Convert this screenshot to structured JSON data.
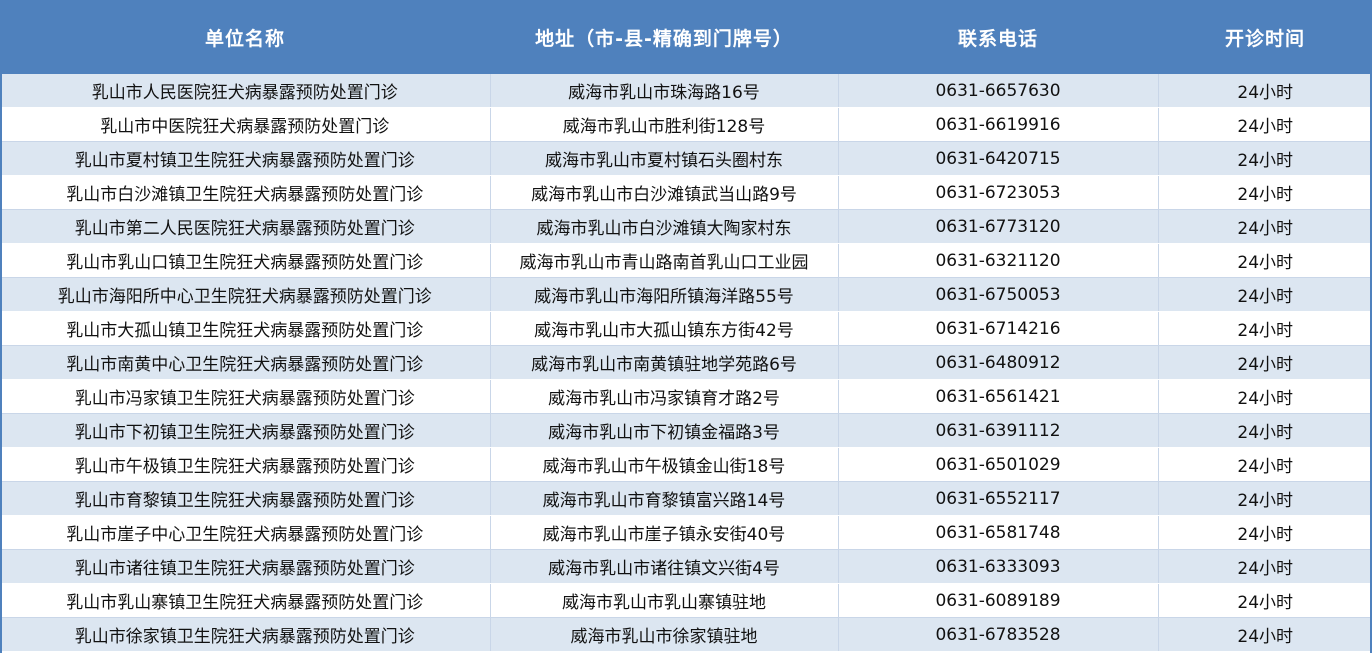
{
  "table": {
    "headers": [
      "单位名称",
      "地址（市-县-精确到门牌号）",
      "联系电话",
      "开诊时间"
    ],
    "rows": [
      [
        "乳山市人民医院狂犬病暴露预防处置门诊",
        "威海市乳山市珠海路16号",
        "0631-6657630",
        "24小时"
      ],
      [
        "乳山市中医院狂犬病暴露预防处置门诊",
        "威海市乳山市胜利街128号",
        "0631-6619916",
        "24小时"
      ],
      [
        "乳山市夏村镇卫生院狂犬病暴露预防处置门诊",
        "威海市乳山市夏村镇石头圈村东",
        "0631-6420715",
        "24小时"
      ],
      [
        "乳山市白沙滩镇卫生院狂犬病暴露预防处置门诊",
        "威海市乳山市白沙滩镇武当山路9号",
        "0631-6723053",
        "24小时"
      ],
      [
        "乳山市第二人民医院狂犬病暴露预防处置门诊",
        "威海市乳山市白沙滩镇大陶家村东",
        "0631-6773120",
        "24小时"
      ],
      [
        "乳山市乳山口镇卫生院狂犬病暴露预防处置门诊",
        "威海市乳山市青山路南首乳山口工业园",
        "0631-6321120",
        "24小时"
      ],
      [
        "乳山市海阳所中心卫生院狂犬病暴露预防处置门诊",
        "威海市乳山市海阳所镇海洋路55号",
        "0631-6750053",
        "24小时"
      ],
      [
        "乳山市大孤山镇卫生院狂犬病暴露预防处置门诊",
        "威海市乳山市大孤山镇东方街42号",
        "0631-6714216",
        "24小时"
      ],
      [
        "乳山市南黄中心卫生院狂犬病暴露预防处置门诊",
        "威海市乳山市南黄镇驻地学苑路6号",
        "0631-6480912",
        "24小时"
      ],
      [
        "乳山市冯家镇卫生院狂犬病暴露预防处置门诊",
        "威海市乳山市冯家镇育才路2号",
        "0631-6561421",
        "24小时"
      ],
      [
        "乳山市下初镇卫生院狂犬病暴露预防处置门诊",
        "威海市乳山市下初镇金福路3号",
        "0631-6391112",
        "24小时"
      ],
      [
        "乳山市午极镇卫生院狂犬病暴露预防处置门诊",
        "威海市乳山市午极镇金山街18号",
        "0631-6501029",
        "24小时"
      ],
      [
        "乳山市育黎镇卫生院狂犬病暴露预防处置门诊",
        "威海市乳山市育黎镇富兴路14号",
        "0631-6552117",
        "24小时"
      ],
      [
        "乳山市崖子中心卫生院狂犬病暴露预防处置门诊",
        "威海市乳山市崖子镇永安街40号",
        "0631-6581748",
        "24小时"
      ],
      [
        "乳山市诸往镇卫生院狂犬病暴露预防处置门诊",
        "威海市乳山市诸往镇文兴街4号",
        "0631-6333093",
        "24小时"
      ],
      [
        "乳山市乳山寨镇卫生院狂犬病暴露预防处置门诊",
        "威海市乳山市乳山寨镇驻地",
        "0631-6089189",
        "24小时"
      ],
      [
        "乳山市徐家镇卫生院狂犬病暴露预防处置门诊",
        "威海市乳山市徐家镇驻地",
        "0631-6783528",
        "24小时"
      ]
    ]
  },
  "colors": {
    "header_bg": "#4f81bd",
    "header_text": "#ffffff",
    "alt_row_bg": "#dce6f1",
    "plain_row_bg": "#ffffff"
  }
}
